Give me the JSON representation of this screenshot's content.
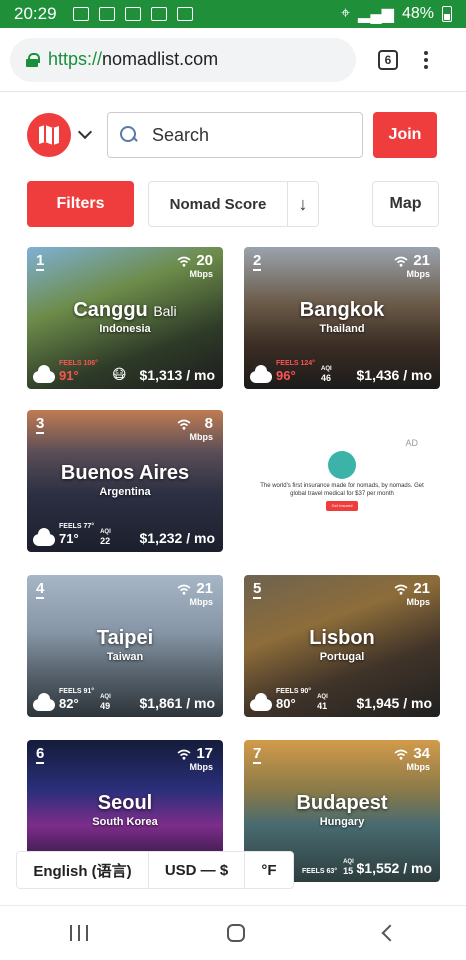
{
  "status_bar": {
    "time": "20:29",
    "battery": "48%"
  },
  "browser": {
    "url_scheme": "https://",
    "url_host": "nomadlist.com",
    "tab_count": "6"
  },
  "header": {
    "search_placeholder": "Search",
    "join_label": "Join"
  },
  "toolbar": {
    "filters_label": "Filters",
    "sort_label": "Nomad Score",
    "sort_direction": "↓",
    "map_label": "Map"
  },
  "cities": [
    {
      "rank": "1",
      "city": "Canggu",
      "city_suffix": "Bali",
      "country": "Indonesia",
      "wifi": "20",
      "wifi_unit": "Mbps",
      "feels": "FEELS 106°",
      "temp": "91°",
      "aqi_label": "",
      "aqi": "",
      "price": "$1,313 / mo",
      "hot": true
    },
    {
      "rank": "2",
      "city": "Bangkok",
      "city_suffix": "",
      "country": "Thailand",
      "wifi": "21",
      "wifi_unit": "Mbps",
      "feels": "FEELS 124°",
      "temp": "96°",
      "aqi_label": "AQI",
      "aqi": "46",
      "price": "$1,436 / mo",
      "hot": true
    },
    {
      "rank": "3",
      "city": "Buenos Aires",
      "city_suffix": "",
      "country": "Argentina",
      "wifi": "8",
      "wifi_unit": "Mbps",
      "feels": "FEELS 77°",
      "temp": "71°",
      "aqi_label": "AQI",
      "aqi": "22",
      "price": "$1,232 / mo",
      "hot": false
    },
    {
      "rank": "4",
      "city": "Taipei",
      "city_suffix": "",
      "country": "Taiwan",
      "wifi": "21",
      "wifi_unit": "Mbps",
      "feels": "FEELS 91°",
      "temp": "82°",
      "aqi_label": "AQI",
      "aqi": "49",
      "price": "$1,861 / mo",
      "hot": false
    },
    {
      "rank": "5",
      "city": "Lisbon",
      "city_suffix": "",
      "country": "Portugal",
      "wifi": "21",
      "wifi_unit": "Mbps",
      "feels": "FEELS 90°",
      "temp": "80°",
      "aqi_label": "AQI",
      "aqi": "41",
      "price": "$1,945 / mo",
      "hot": false
    },
    {
      "rank": "6",
      "city": "Seoul",
      "city_suffix": "",
      "country": "South Korea",
      "wifi": "17",
      "wifi_unit": "Mbps",
      "feels": "",
      "temp": "",
      "aqi_label": "",
      "aqi": "",
      "price": "",
      "hot": false
    },
    {
      "rank": "7",
      "city": "Budapest",
      "city_suffix": "",
      "country": "Hungary",
      "wifi": "34",
      "wifi_unit": "Mbps",
      "feels": "FEELS 63°",
      "temp": "",
      "aqi_label": "AQI",
      "aqi": "15",
      "price": "$1,552 / mo",
      "hot": false
    }
  ],
  "ad": {
    "tag": "AD",
    "text": "The world's first insurance made for nomads, by nomads. Get global travel medical for $37 per month",
    "button": "Get Insured"
  },
  "footer": {
    "language": "English (语言)",
    "currency": "USD — $",
    "temperature": "°F"
  }
}
